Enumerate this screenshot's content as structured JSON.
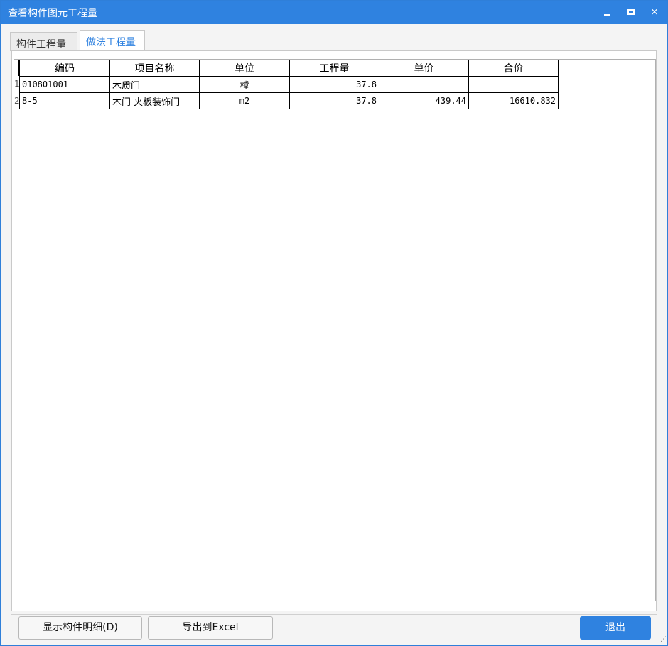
{
  "window": {
    "title": "查看构件图元工程量",
    "controls": {
      "minimize": "",
      "maximize": "",
      "close": "×"
    }
  },
  "tabs": [
    {
      "label": "构件工程量",
      "active": false
    },
    {
      "label": "做法工程量",
      "active": true
    }
  ],
  "table": {
    "columns": [
      "编码",
      "项目名称",
      "单位",
      "工程量",
      "单价",
      "合价"
    ],
    "rows": [
      {
        "index": "1",
        "code": "010801001",
        "name": "木质门",
        "unit": "樘",
        "quantity": "37.8",
        "unit_price": "",
        "total": ""
      },
      {
        "index": "2",
        "code": "8-5",
        "name": "木门 夹板装饰门",
        "unit": "m2",
        "quantity": "37.8",
        "unit_price": "439.44",
        "total": "16610.832"
      }
    ]
  },
  "footer": {
    "show_detail_label": "显示构件明细(D)",
    "export_label": "导出到Excel",
    "exit_label": "退出"
  },
  "colors": {
    "accent": "#2f82e0"
  }
}
